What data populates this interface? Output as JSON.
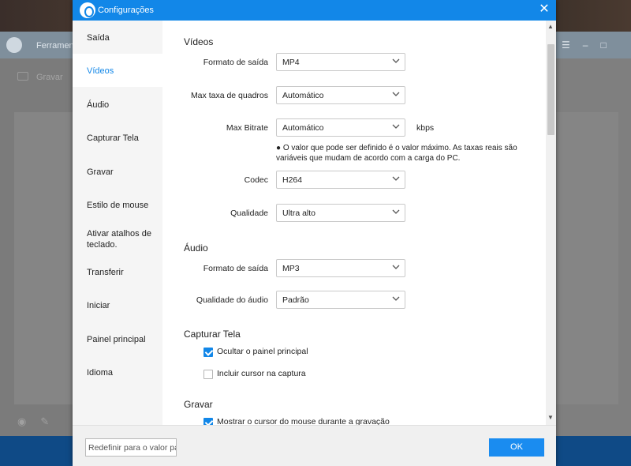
{
  "background": {
    "app_title": "Ferramen",
    "toolbar_label": "Gravar"
  },
  "dialog": {
    "title": "Configurações",
    "close_glyph": "✕"
  },
  "sidebar": {
    "items": [
      {
        "label": "Saída"
      },
      {
        "label": "Vídeos",
        "active": true
      },
      {
        "label": "Áudio"
      },
      {
        "label": "Capturar Tela"
      },
      {
        "label": "Gravar"
      },
      {
        "label": "Estilo de mouse"
      },
      {
        "label": "Ativar atalhos de teclado."
      },
      {
        "label": "Transferir"
      },
      {
        "label": "Iniciar"
      },
      {
        "label": "Painel principal"
      },
      {
        "label": "Idioma"
      }
    ]
  },
  "video": {
    "section_title": "Vídeos",
    "output_format": {
      "label": "Formato de saída",
      "value": "MP4"
    },
    "max_framerate": {
      "label": "Max taxa de quadros",
      "value": "Automático"
    },
    "max_bitrate": {
      "label": "Max Bitrate",
      "value": "Automático",
      "unit": "kbps"
    },
    "bitrate_note": "● O valor que pode ser definido é o valor máximo. As taxas reais são variáveis que mudam de acordo com a carga do PC.",
    "codec": {
      "label": "Codec",
      "value": "H264"
    },
    "quality": {
      "label": "Qualidade",
      "value": "Ultra alto"
    }
  },
  "audio": {
    "section_title": "Áudio",
    "output_format": {
      "label": "Formato de saída",
      "value": "MP3"
    },
    "quality": {
      "label": "Qualidade do áudio",
      "value": "Padrão"
    }
  },
  "capture": {
    "section_title": "Capturar Tela",
    "hide_panel": {
      "label": "Ocultar o painel principal",
      "checked": true
    },
    "include_cursor": {
      "label": "Incluir cursor na captura",
      "checked": false
    }
  },
  "record": {
    "section_title": "Gravar",
    "show_cursor": {
      "label": "Mostrar o cursor do mouse durante a gravação",
      "checked": true
    }
  },
  "footer": {
    "reset_label": "Redefinir para o valor pa",
    "ok_label": "OK"
  },
  "colors": {
    "accent": "#1287e8",
    "titlebar": "#1287e8",
    "ok_button": "#1a8cf0"
  }
}
